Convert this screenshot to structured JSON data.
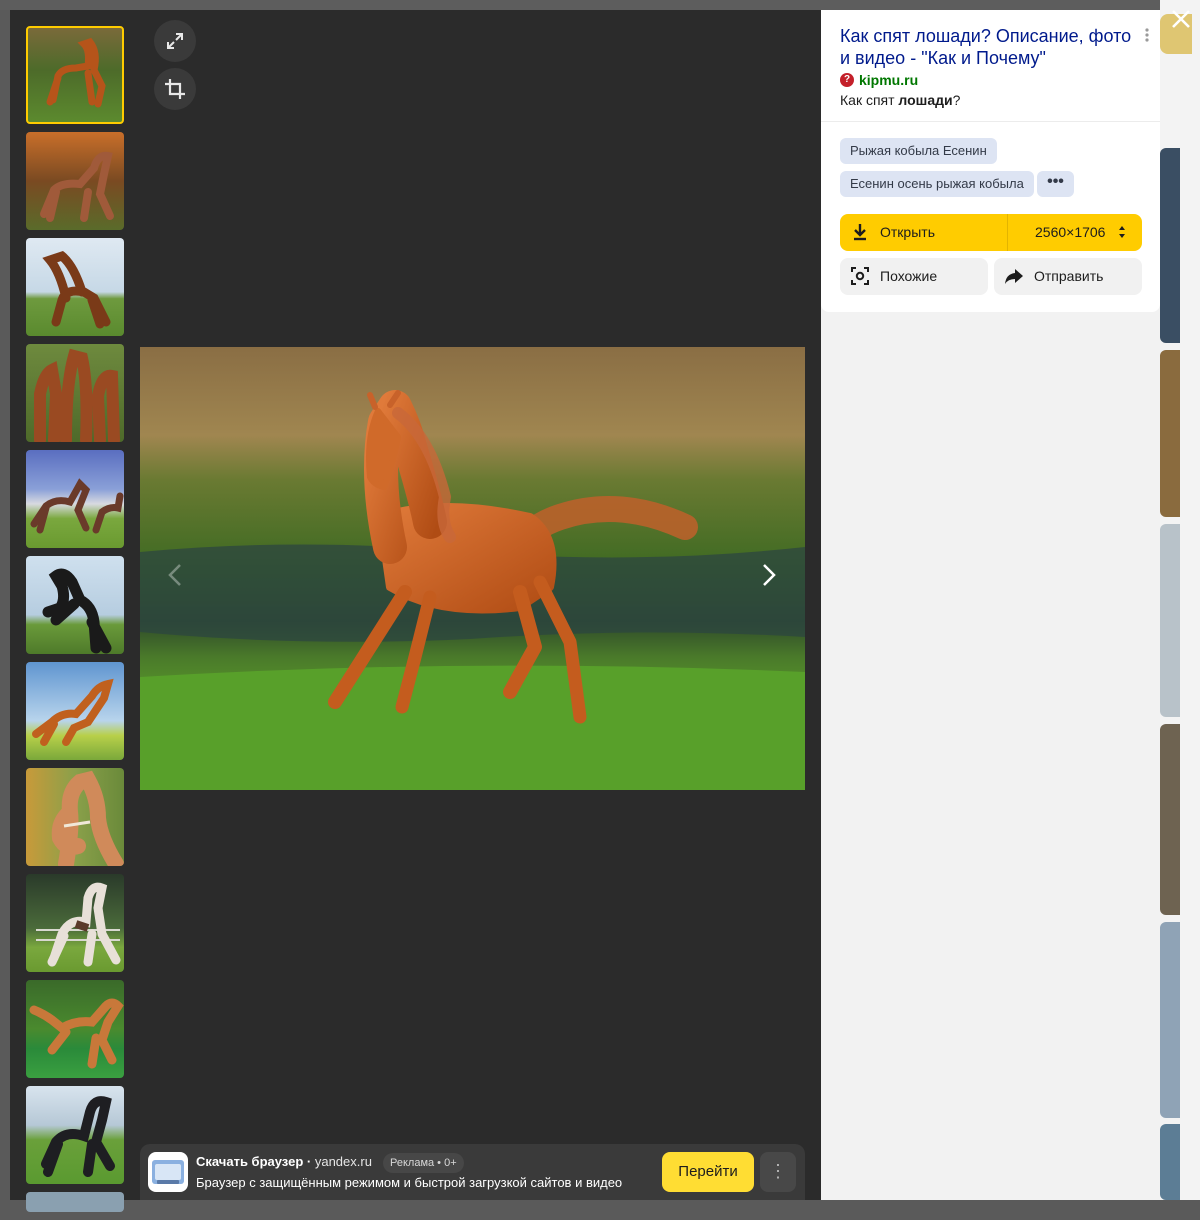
{
  "result": {
    "title": "Как спят лошади? Описание, фото и видео - \"Как и Почему\"",
    "source_domain": "kipmu.ru",
    "snippet_prefix": "Как спят ",
    "snippet_bold": "лошади",
    "snippet_suffix": "?"
  },
  "tags": [
    "Рыжая кобыла Есенин",
    "Есенин осень рыжая кобыла"
  ],
  "tags_more_label": "•••",
  "actions": {
    "open_label": "Открыть",
    "size_label": "2560×1706",
    "similar_label": "Похожие",
    "share_label": "Отправить"
  },
  "ad": {
    "title": "Скачать браузер",
    "domain": "yandex.ru",
    "badge": "Реклама • 0+",
    "text": "Браузер с защищённым режимом и быстрой загрузкой сайтов и видео",
    "go_label": "Перейти",
    "menu_label": "⋮"
  },
  "thumbnails": [
    "chestnut-horse-field",
    "horse-autumn-trees",
    "bay-horse-running-sky",
    "three-horses-portrait",
    "horses-running-herd",
    "black-horse-rearing",
    "chestnut-horse-jumping",
    "horse-head-halter",
    "pinto-horse-galloping",
    "chestnut-horse-galloping",
    "black-horse-galloping"
  ],
  "icons": {
    "fullscreen": "expand-icon",
    "crop": "crop-icon",
    "close": "close-icon",
    "download": "download-icon",
    "similar": "lens-icon",
    "share": "share-icon",
    "source": "question-icon"
  },
  "colors": {
    "accent": "#ffcc00",
    "title_link": "#001a8c",
    "domain": "#007700",
    "viewer_bg": "#2b2b2b"
  }
}
